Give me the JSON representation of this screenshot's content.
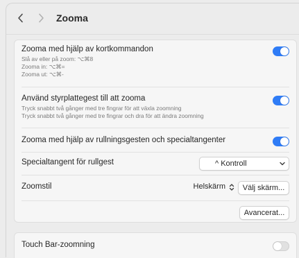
{
  "window": {
    "title": "Zooma"
  },
  "colors": {
    "accent": "#2f7cf6",
    "card_bg": "#f6f6f6",
    "window_bg": "#ececec"
  },
  "settings": {
    "keyboard": {
      "title": "Zooma med hjälp av kortkommandon",
      "lines": [
        "Slå av eller på zoom: ⌥⌘8",
        "Zooma in: ⌥⌘=",
        "Zooma ut: ⌥⌘-"
      ],
      "enabled": true
    },
    "trackpad": {
      "title": "Använd styrplattegest till att zooma",
      "lines": [
        "Tryck snabbt två gånger med tre fingrar för att växla zoomning",
        "Tryck snabbt två gånger med tre fingrar och dra för att ändra zoomning"
      ],
      "enabled": true
    },
    "scroll": {
      "title": "Zooma med hjälp av rullningsgesten och specialtangenter",
      "enabled": true
    },
    "modifier": {
      "label": "Specialtangent för rullgest",
      "value": "^ Kontroll"
    },
    "style": {
      "label": "Zoomstil",
      "value": "Helskärm",
      "choose_button": "Välj skärm..."
    },
    "advanced_button": "Avancerat...",
    "touchbar": {
      "title": "Touch Bar-zoomning",
      "enabled": false
    }
  },
  "icons": {
    "back": "chevron-left-icon",
    "forward": "chevron-right-icon",
    "popup": "chevron-down-icon",
    "stepper": "up-down-arrows-icon"
  }
}
